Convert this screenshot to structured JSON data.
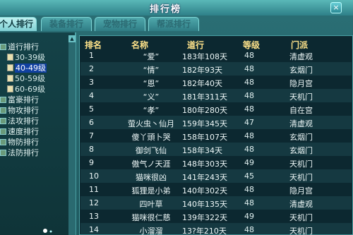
{
  "window": {
    "title": "排行榜",
    "close_label": "×"
  },
  "tabs": [
    {
      "label": "个人排行",
      "active": true
    },
    {
      "label": "装备排行",
      "active": false
    },
    {
      "label": "宠物排行",
      "active": false
    },
    {
      "label": "帮派排行",
      "active": false
    }
  ],
  "sidebar": {
    "items": [
      {
        "label": "道行排行",
        "kind": "group"
      },
      {
        "label": "30-39级",
        "kind": "sub"
      },
      {
        "label": "40-49级",
        "kind": "sub",
        "selected": true
      },
      {
        "label": "50-59级",
        "kind": "sub"
      },
      {
        "label": "60-69级",
        "kind": "sub"
      },
      {
        "label": "富豪排行",
        "kind": "group"
      },
      {
        "label": "物攻排行",
        "kind": "group"
      },
      {
        "label": "法攻排行",
        "kind": "group"
      },
      {
        "label": "速度排行",
        "kind": "group"
      },
      {
        "label": "物防排行",
        "kind": "group"
      },
      {
        "label": "法防排行",
        "kind": "group"
      }
    ]
  },
  "table": {
    "headers": [
      "排名",
      "名称",
      "道行",
      "等级",
      "门派"
    ],
    "rows": [
      [
        "1",
        "“爱”",
        "183年108天",
        "48",
        "清虚观"
      ],
      [
        "2",
        "“情”",
        "182年93天",
        "48",
        "玄烟门"
      ],
      [
        "3",
        "“恩”",
        "182年40天",
        "48",
        "隐月宫"
      ],
      [
        "4",
        "“义”",
        "181年311天",
        "48",
        "天机门"
      ],
      [
        "5",
        "“孝”",
        "180年280天",
        "48",
        "自在宫"
      ],
      [
        "6",
        "萤火虫丶仙月",
        "159年345天",
        "47",
        "清虚观"
      ],
      [
        "7",
        "傻丫頭卜哭",
        "158年107天",
        "48",
        "玄烟门"
      ],
      [
        "8",
        "御剑飞仙",
        "158年34天",
        "48",
        "玄烟门"
      ],
      [
        "9",
        "傲气ノ天涯",
        "148年303天",
        "49",
        "天机门"
      ],
      [
        "10",
        "猫咪很凶",
        "141年243天",
        "45",
        "天机门"
      ],
      [
        "11",
        "狐狸是小弟",
        "140年302天",
        "48",
        "隐月宫"
      ],
      [
        "12",
        "四叶草",
        "140年135天",
        "48",
        "清虚观"
      ],
      [
        "13",
        "猫咪很仁慈",
        "139年322天",
        "49",
        "天机门"
      ],
      [
        "14",
        "小溜溜",
        "13?年210天",
        "48",
        "天机门"
      ]
    ]
  },
  "colors": {
    "header_text": "#ffe38a",
    "selection": "#1040a0",
    "panel": "#0c2830"
  }
}
